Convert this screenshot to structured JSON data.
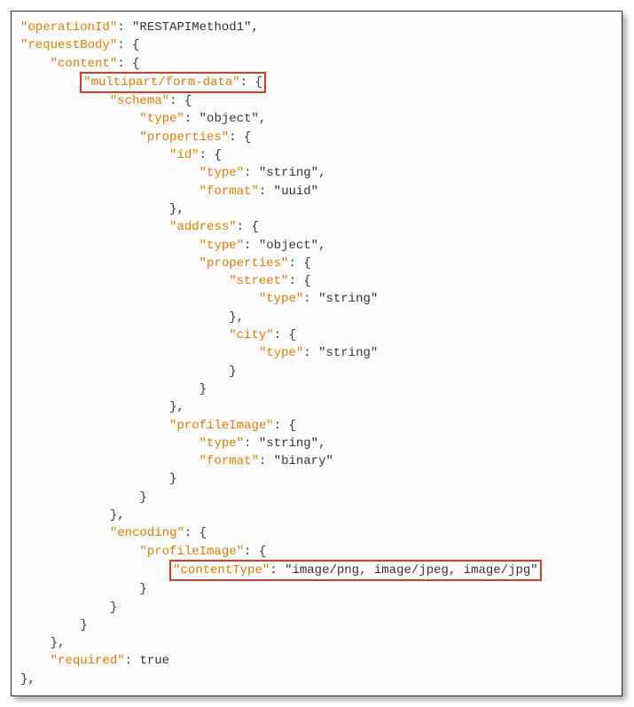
{
  "code": {
    "operationId_key": "\"operationId\"",
    "operationId_val": "\"RESTAPIMethod1\"",
    "requestBody_key": "\"requestBody\"",
    "content_key": "\"content\"",
    "mp_key": "\"multipart/form-data\"",
    "schema_key": "\"schema\"",
    "type_key": "\"type\"",
    "type_object": "\"object\"",
    "type_string": "\"string\"",
    "properties_key": "\"properties\"",
    "id_key": "\"id\"",
    "format_key": "\"format\"",
    "format_uuid": "\"uuid\"",
    "address_key": "\"address\"",
    "street_key": "\"street\"",
    "city_key": "\"city\"",
    "profileImage_key": "\"profileImage\"",
    "format_binary": "\"binary\"",
    "encoding_key": "\"encoding\"",
    "contentType_key": "\"contentType\"",
    "contentType_val": "\"image/png, image/jpeg, image/jpg\"",
    "required_key": "\"required\"",
    "required_val": "true"
  }
}
